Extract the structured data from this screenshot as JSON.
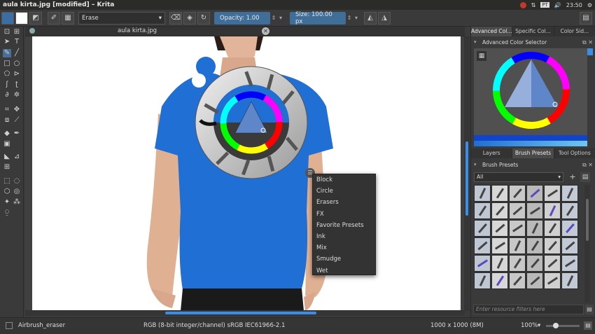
{
  "window": {
    "title": "aula kirta.jpg [modified] – Krita"
  },
  "tray": {
    "clock": "23:50",
    "keyboard": "PT",
    "icons": [
      "record-icon",
      "network-icon",
      "keyboard-icon",
      "volume-icon",
      "power-icon"
    ]
  },
  "toolbar": {
    "preset_name": "Erase",
    "opacity_label": "Opacity:  1.00",
    "size_label": "Size:  100.00 px"
  },
  "document": {
    "tab_name": "aula kirta.jpg",
    "close_glyph": "✕"
  },
  "popup_menu": {
    "items": [
      "Block",
      "Circle",
      "Erasers",
      "FX",
      "Favorite Presets",
      "Ink",
      "Mix",
      "Smudge",
      "Wet"
    ]
  },
  "right_panel": {
    "top_tabs": [
      "Advanced Col...",
      "Specific Col...",
      "Color Sid..."
    ],
    "color_selector_title": "Advanced Color Selector",
    "mid_tabs": [
      "Layers",
      "Brush Presets",
      "Tool Options"
    ],
    "brush_presets_title": "Brush Presets",
    "tag_filter": "All",
    "filter_placeholder": "Enter resource filters here"
  },
  "status": {
    "brush": "Airbrush_eraser",
    "color_model": "RGB (8-bit integer/channel)  sRGB IEC61966-2.1",
    "dimensions": "1000 x 1000 (8M)",
    "zoom": "100%"
  },
  "colors": {
    "accent": "#3a8ee6",
    "shirt": "#1f6fd4",
    "panel": "#3a3a3a"
  }
}
